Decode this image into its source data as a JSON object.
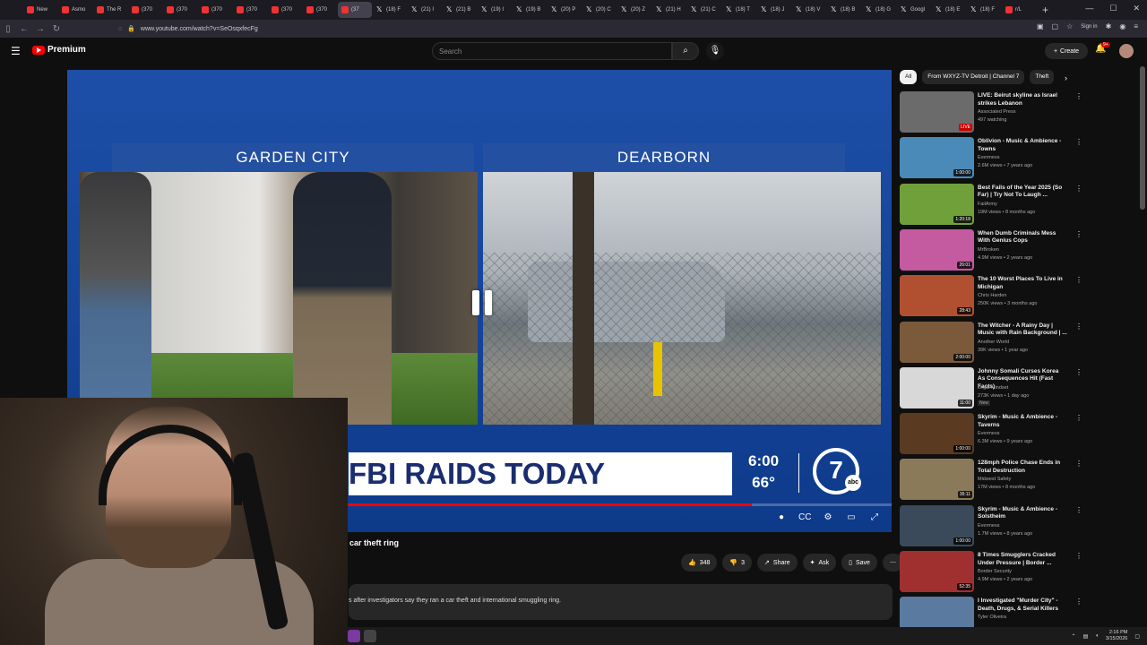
{
  "browser": {
    "tabs": [
      {
        "label": "New",
        "fav": "red"
      },
      {
        "label": "Asmo",
        "fav": "red"
      },
      {
        "label": "The R",
        "fav": "red"
      },
      {
        "label": "(370",
        "fav": "red"
      },
      {
        "label": "(370",
        "fav": "red"
      },
      {
        "label": "(370",
        "fav": "red"
      },
      {
        "label": "(370",
        "fav": "red"
      },
      {
        "label": "(370",
        "fav": "red"
      },
      {
        "label": "(370",
        "fav": "red"
      },
      {
        "label": "(37",
        "fav": "red",
        "active": true
      },
      {
        "label": "(18) F",
        "fav": "x"
      },
      {
        "label": "(21) I",
        "fav": "x"
      },
      {
        "label": "(21) B",
        "fav": "x"
      },
      {
        "label": "(19) I",
        "fav": "x"
      },
      {
        "label": "(19) B",
        "fav": "x"
      },
      {
        "label": "(20) P",
        "fav": "x"
      },
      {
        "label": "(20) C",
        "fav": "x"
      },
      {
        "label": "(20) Z",
        "fav": "x"
      },
      {
        "label": "(21) H",
        "fav": "x"
      },
      {
        "label": "(21) C",
        "fav": "x"
      },
      {
        "label": "(18) T",
        "fav": "x"
      },
      {
        "label": "(18) J",
        "fav": "x"
      },
      {
        "label": "(18) V",
        "fav": "x"
      },
      {
        "label": "(18) B",
        "fav": "x"
      },
      {
        "label": "(18) G",
        "fav": "x"
      },
      {
        "label": "Googl",
        "fav": "x"
      },
      {
        "label": "(18) E",
        "fav": "x"
      },
      {
        "label": "(18) F",
        "fav": "x"
      },
      {
        "label": "r/L",
        "fav": "red"
      }
    ],
    "url": "www.youtube.com/watch?v=SeOsqxfecFg",
    "sign_in": "Sign in"
  },
  "header": {
    "logo_text": "Premium",
    "search_placeholder": "Search",
    "create_label": "Create",
    "notif_count": "9+"
  },
  "player": {
    "left_label": "GARDEN CITY",
    "right_label": "DEARBORN",
    "lower_third": "FBI RAIDS TODAY",
    "time": "6:00",
    "temp": "66°",
    "station_logo": "7",
    "network": "abc",
    "progress": 0.83
  },
  "video": {
    "title": "car theft ring",
    "likes": "348",
    "dislikes": "3",
    "share": "Share",
    "ask": "Ask",
    "save": "Save",
    "description": "s after investigators say they ran a car theft and international smuggling ring."
  },
  "sidebar": {
    "chips": [
      "All",
      "From WXYZ-TV Detroit | Channel 7",
      "Theft"
    ],
    "items": [
      {
        "title": "LIVE: Beirut skyline as Israel strikes Lebanon",
        "channel": "Associated Press",
        "meta": "497 watching",
        "badge_live": "LIVE",
        "thumb": "#6b6b6b"
      },
      {
        "title": "Oblivion - Music & Ambience - Towns",
        "channel": "Evermess",
        "meta": "2.6M views • 7 years ago",
        "duration": "1:00:00",
        "thumb": "#4a8ab8"
      },
      {
        "title": "Best Fails of the Year 2025 (So Far) | Try Not To Laugh ...",
        "channel": "FailArmy",
        "meta": "19M views • 8 months ago",
        "duration": "1:20:18",
        "thumb": "#6fa03a"
      },
      {
        "title": "When Dumb Criminals Mess With Genius Cops",
        "channel": "MrBroken",
        "meta": "4.9M views • 2 years ago",
        "duration": "26:01",
        "thumb": "#c45aa0"
      },
      {
        "title": "The 10 Worst Places To Live in Michigan",
        "channel": "Chris Harden",
        "meta": "250K views • 3 months ago",
        "duration": "28:43",
        "thumb": "#b05030"
      },
      {
        "title": "The Witcher - A Rainy Day | Music with Rain Background | ...",
        "channel": "Another World",
        "meta": "39K views • 1 year ago",
        "duration": "2:00:00",
        "thumb": "#7a5a3a"
      },
      {
        "title": "Johnny Somali Curses Korea As Consequences Hit (Fast Facts)",
        "channel": "Legal Mindset",
        "meta": "273K views • 1 day ago",
        "badge": "New",
        "duration": "11:00",
        "thumb": "#d8d8d8"
      },
      {
        "title": "Skyrim - Music & Ambience - Taverns",
        "channel": "Evermess",
        "meta": "6.3M views • 9 years ago",
        "duration": "1:00:00",
        "thumb": "#5a3a20"
      },
      {
        "title": "128mph Police Chase Ends in Total Destruction",
        "channel": "Midwest Safety",
        "meta": "17M views • 8 months ago",
        "duration": "35:11",
        "thumb": "#8a7a5a"
      },
      {
        "title": "Skyrim - Music & Ambience - Solstheim",
        "channel": "Evermess",
        "meta": "1.7M views • 8 years ago",
        "duration": "1:00:00",
        "thumb": "#3a4a5a"
      },
      {
        "title": "8 Times Smugglers Cracked Under Pressure | Border ...",
        "channel": "Border Security",
        "meta": "4.9M views • 2 years ago",
        "duration": "52:35",
        "thumb": "#a03030"
      },
      {
        "title": "I Investigated \"Murder City\" - Death, Drugs, & Serial Killers",
        "channel": "Tyler Oliveira",
        "meta": "",
        "thumb": "#5a7aa0"
      }
    ]
  },
  "taskbar": {
    "time": "2:16 PM",
    "date": "3/15/2026"
  },
  "colors": {
    "accent": "#ff0000",
    "news_blue": "#1d4fa8",
    "lower_third_text": "#1a2d6e"
  }
}
